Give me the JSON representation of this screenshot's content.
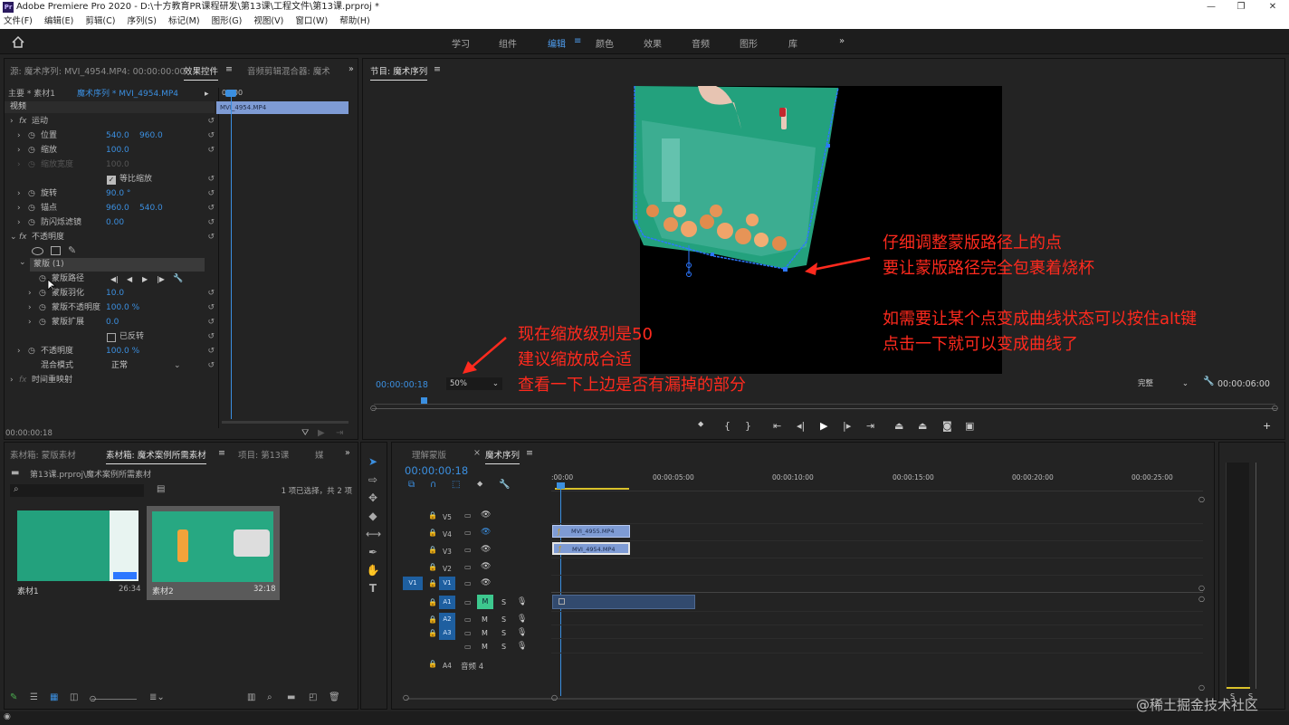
{
  "window": {
    "title": "Adobe Premiere Pro 2020 - D:\\十方教育PR课程研发\\第13课\\工程文件\\第13课.prproj *",
    "app_icon": "Pr",
    "controls": [
      "—",
      "❐",
      "✕"
    ]
  },
  "menu": [
    "文件(F)",
    "编辑(E)",
    "剪辑(C)",
    "序列(S)",
    "标记(M)",
    "图形(G)",
    "视图(V)",
    "窗口(W)",
    "帮助(H)"
  ],
  "workspaces": {
    "items": [
      "学习",
      "组件",
      "编辑",
      "颜色",
      "效果",
      "音频",
      "图形",
      "库"
    ],
    "active": "编辑",
    "more": "»"
  },
  "source_panel": {
    "tabs": [
      "源: 魔术序列: MVI_4954.MP4: 00:00:00:00",
      "效果控件",
      "音频剪辑混合器: 魔术"
    ],
    "active_tab": "效果控件",
    "header_clip": "主要 * 素材1",
    "header_seq": "魔术序列 * MVI_4954.MP4",
    "timeline_start": "00:00",
    "mini_clip": "MVI_4954.MP4",
    "section_video": "视频",
    "rows": [
      {
        "label": "运动",
        "type": "fx"
      },
      {
        "label": "位置",
        "v1": "540.0",
        "v2": "960.0"
      },
      {
        "label": "缩放",
        "v1": "100.0"
      },
      {
        "label": "缩放宽度",
        "v1": "100.0",
        "disabled": true
      },
      {
        "label": "等比缩放",
        "check": true
      },
      {
        "label": "旋转",
        "v1": "90.0 °"
      },
      {
        "label": "锚点",
        "v1": "960.0",
        "v2": "540.0"
      },
      {
        "label": "防闪烁滤镜",
        "v1": "0.00"
      },
      {
        "label": "不透明度",
        "type": "fx"
      },
      {
        "label": "蒙版 (1)"
      },
      {
        "label": "蒙版路径"
      },
      {
        "label": "蒙版羽化",
        "v1": "10.0"
      },
      {
        "label": "蒙版不透明度",
        "v1": "100.0 %"
      },
      {
        "label": "蒙版扩展",
        "v1": "0.0"
      },
      {
        "label": "已反转",
        "check": false
      },
      {
        "label": "不透明度",
        "v1": "100.0 %"
      },
      {
        "label": "混合模式",
        "v1": "正常"
      },
      {
        "label": "时间重映射",
        "type": "fx"
      }
    ],
    "timecode": "00:00:00:18"
  },
  "program_monitor": {
    "title": "节目: 魔术序列",
    "timecode": "00:00:00:18",
    "zoom": "50%",
    "quality": "完整",
    "duration": "00:00:06:00"
  },
  "annotations": {
    "right_1": "仔细调整蒙版路径上的点",
    "right_2": "要让蒙版路径完全包裹着烧杯",
    "right_3": "如需要让某个点变成曲线状态可以按住alt键",
    "right_4": "点击一下就可以变成曲线了",
    "left_1": "现在缩放级别是50",
    "left_2": "建议缩放成合适",
    "left_3": "查看一下上边是否有漏掉的部分"
  },
  "project_panel": {
    "tabs": [
      "素材箱: 蒙版素材",
      "素材箱: 魔术案例所需素材",
      "项目: 第13课",
      "媒"
    ],
    "active_tab": "素材箱: 魔术案例所需素材",
    "path": "第13课.prproj\\魔术案例所需素材",
    "status": "1 项已选择，共 2 项",
    "items": [
      {
        "name": "素材1",
        "duration": "26:34"
      },
      {
        "name": "素材2",
        "duration": "32:18"
      }
    ]
  },
  "timeline": {
    "tabs": [
      "理解蒙版",
      "魔术序列"
    ],
    "active_tab": "魔术序列",
    "timecode": "00:00:00:18",
    "ruler": [
      ":00:00",
      "00:00:05:00",
      "00:00:10:00",
      "00:00:15:00",
      "00:00:20:00",
      "00:00:25:00"
    ],
    "video_tracks": [
      "V5",
      "V4",
      "V3",
      "V2",
      "V1"
    ],
    "audio_tracks": [
      "A1",
      "A2",
      "A3",
      "A4"
    ],
    "a4_name": "音频 4",
    "clips": [
      {
        "name": "MVI_4955.MP4",
        "track": "V4"
      },
      {
        "name": "MVI_4954.MP4",
        "track": "V3"
      }
    ],
    "source_patch_v": "V1",
    "toggle_m": "M",
    "toggle_s": "S",
    "meter_labels": [
      "S",
      "S"
    ]
  },
  "watermark": "@稀土掘金技术社区",
  "colors": {
    "accent": "#3b8fe0",
    "annotation": "#ff2a1e",
    "clip": "#7e9bd4",
    "green_screen": "#23a17d"
  }
}
